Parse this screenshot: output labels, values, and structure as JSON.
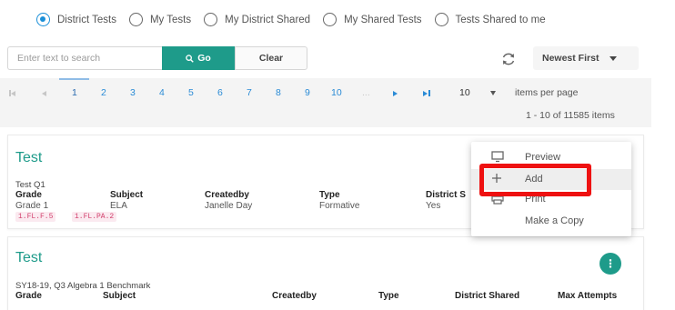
{
  "filters": {
    "options": [
      {
        "label": "District Tests",
        "checked": true
      },
      {
        "label": "My Tests",
        "checked": false
      },
      {
        "label": "My District Shared",
        "checked": false
      },
      {
        "label": "My Shared Tests",
        "checked": false
      },
      {
        "label": "Tests Shared to me",
        "checked": false
      }
    ]
  },
  "search": {
    "placeholder": "Enter text to search",
    "value": "",
    "go_label": "Go",
    "clear_label": "Clear"
  },
  "sort": {
    "selected": "Newest First"
  },
  "pager": {
    "pages": [
      "1",
      "2",
      "3",
      "4",
      "5",
      "6",
      "7",
      "8",
      "9",
      "10",
      "..."
    ],
    "current_page": "1",
    "per_page": "10",
    "per_page_label": "items per page",
    "range_info": "1 - 10 of 11585 items"
  },
  "cards": [
    {
      "title": "Test",
      "description": "Test Q1",
      "headers": [
        "Grade",
        "Subject",
        "Createdby",
        "Type",
        "District S"
      ],
      "values": [
        "Grade 1",
        "ELA",
        "Janelle Day",
        "Formative",
        "Yes"
      ],
      "tags": [
        "1.FL.F.5",
        "1.FL.PA.2"
      ]
    },
    {
      "title": "Test",
      "description": "SY18-19, Q3 Algebra 1 Benchmark",
      "headers": [
        "Grade",
        "Subject",
        "Createdby",
        "Type",
        "District Shared",
        "Max Attempts"
      ]
    }
  ],
  "menu": {
    "items": [
      {
        "label": "Preview",
        "icon": "monitor-icon"
      },
      {
        "label": "Add",
        "icon": "plus-icon"
      },
      {
        "label": "Print",
        "icon": "printer-icon"
      },
      {
        "label": "Make a Copy",
        "icon": ""
      }
    ]
  },
  "colors": {
    "accent": "#1e9b8a",
    "link": "#2a8bd6",
    "radio": "#1a8fd8",
    "highlight": "#ee1111"
  }
}
